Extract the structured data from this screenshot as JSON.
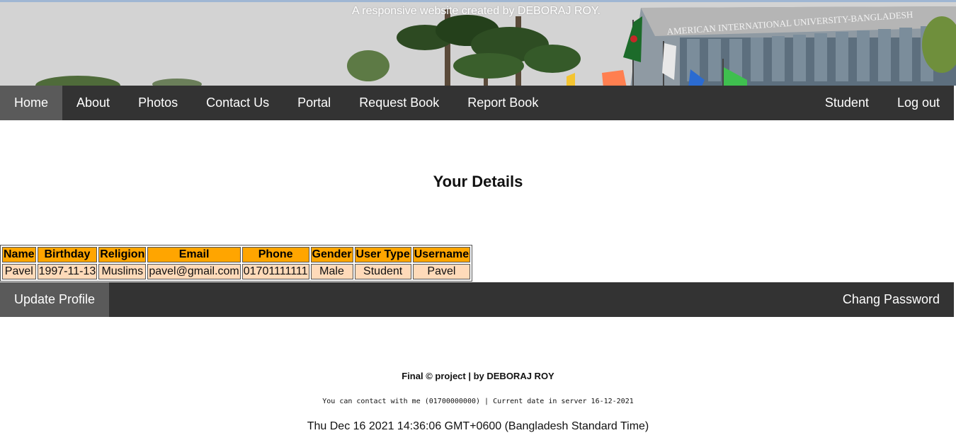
{
  "banner": {
    "caption": "A responsive website created by DEBORAJ ROY.",
    "building_sign": "AMERICAN INTERNATIONAL UNIVERSITY-BANGLADESH"
  },
  "nav": {
    "home": "Home",
    "about": "About",
    "photos": "Photos",
    "contact": "Contact Us",
    "portal": "Portal",
    "request_book": "Request Book",
    "report_book": "Report Book",
    "student": "Student",
    "logout": "Log out"
  },
  "main": {
    "title": "Your Details",
    "table": {
      "headers": [
        "Name",
        "Birthday",
        "Religion",
        "Email",
        "Phone",
        "Gender",
        "User Type",
        "Username"
      ],
      "row": [
        "Pavel",
        "1997-11-13",
        "Muslims",
        "pavel@gmail.com",
        "01701111111",
        "Male",
        "Student",
        "Pavel"
      ]
    }
  },
  "profile_nav": {
    "update_profile": "Update Profile",
    "change_password": "Chang Password"
  },
  "footer": {
    "title": "Final © project | by DEBORAJ ROY",
    "contact": "You can contact with me (01700000000) | Current date in server 16-12-2021",
    "clock": "Thu Dec 16 2021 14:36:06 GMT+0600 (Bangladesh Standard Time)"
  },
  "colors": {
    "nav_bg": "#333333",
    "nav_active": "#5a5a5a",
    "table_header": "#ffa500",
    "table_cell": "#ffdab9"
  }
}
